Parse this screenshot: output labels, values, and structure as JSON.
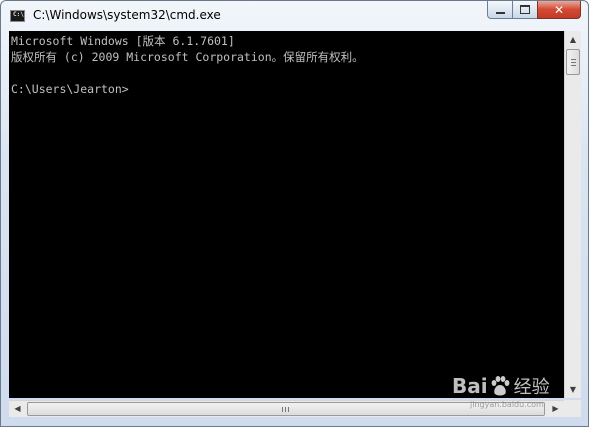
{
  "window": {
    "title": "C:\\Windows\\system32\\cmd.exe",
    "icon_label": "C:\\",
    "controls": {
      "close_label": "✕"
    }
  },
  "console": {
    "lines": [
      "Microsoft Windows [版本 6.1.7601]",
      "版权所有 (c) 2009 Microsoft Corporation。保留所有权利。",
      "",
      "C:\\Users\\Jearton>"
    ]
  },
  "scrollbars": {
    "up_arrow": "▲",
    "down_arrow": "▼",
    "left_arrow": "◀",
    "right_arrow": "▶"
  },
  "watermark": {
    "brand_left": "Bai",
    "brand_right": "经验",
    "url": "jingyan.baidu.com"
  },
  "colors": {
    "console_bg": "#000000",
    "console_fg": "#c0c0c0",
    "close_button": "#c9412c"
  }
}
